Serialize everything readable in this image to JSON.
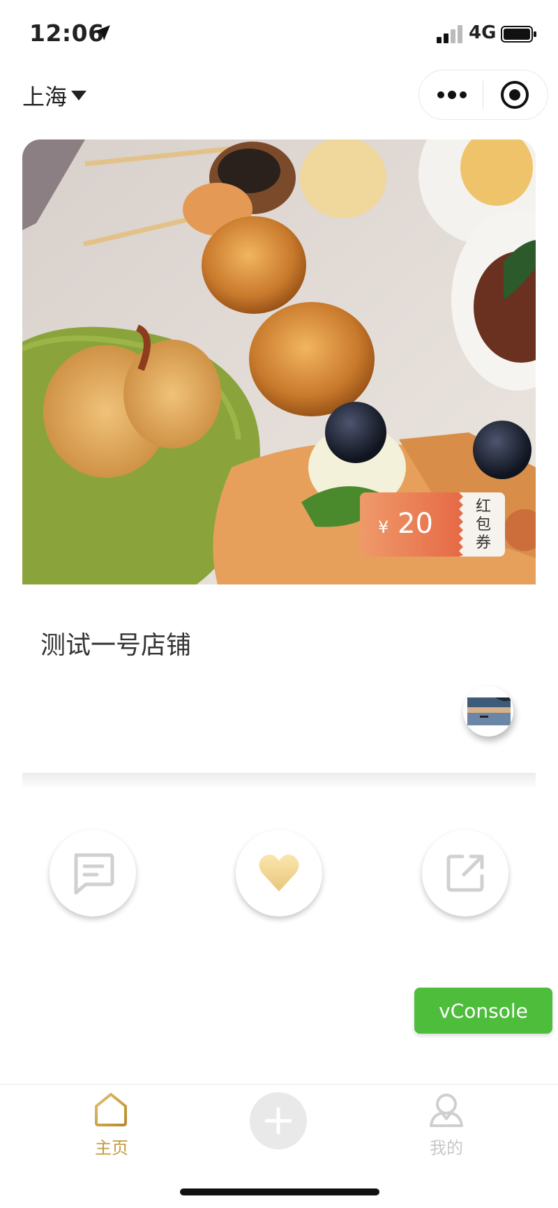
{
  "status_bar": {
    "time": "12:06",
    "network": "4G"
  },
  "nav": {
    "city": "上海",
    "icons": [
      "caret-down-icon",
      "more-dots-icon",
      "target-icon"
    ]
  },
  "hero": {
    "image": "food-platter-photo"
  },
  "coupon": {
    "currency": "¥",
    "value": "20",
    "label": "红包券"
  },
  "store": {
    "name": "测试一号店铺"
  },
  "actions": [
    "comment-icon",
    "heart-icon",
    "share-icon"
  ],
  "vconsole": {
    "label": "vConsole"
  },
  "tabbar": {
    "items": [
      {
        "label": "主页",
        "icon": "home-icon",
        "active": true
      },
      {
        "label": "",
        "icon": "plus-icon",
        "active": false
      },
      {
        "label": "我的",
        "icon": "user-icon",
        "active": false
      }
    ]
  },
  "colors": {
    "accent": "#c49a3e",
    "coupon": "#e66b47",
    "vconsole": "#4ebd3c"
  }
}
